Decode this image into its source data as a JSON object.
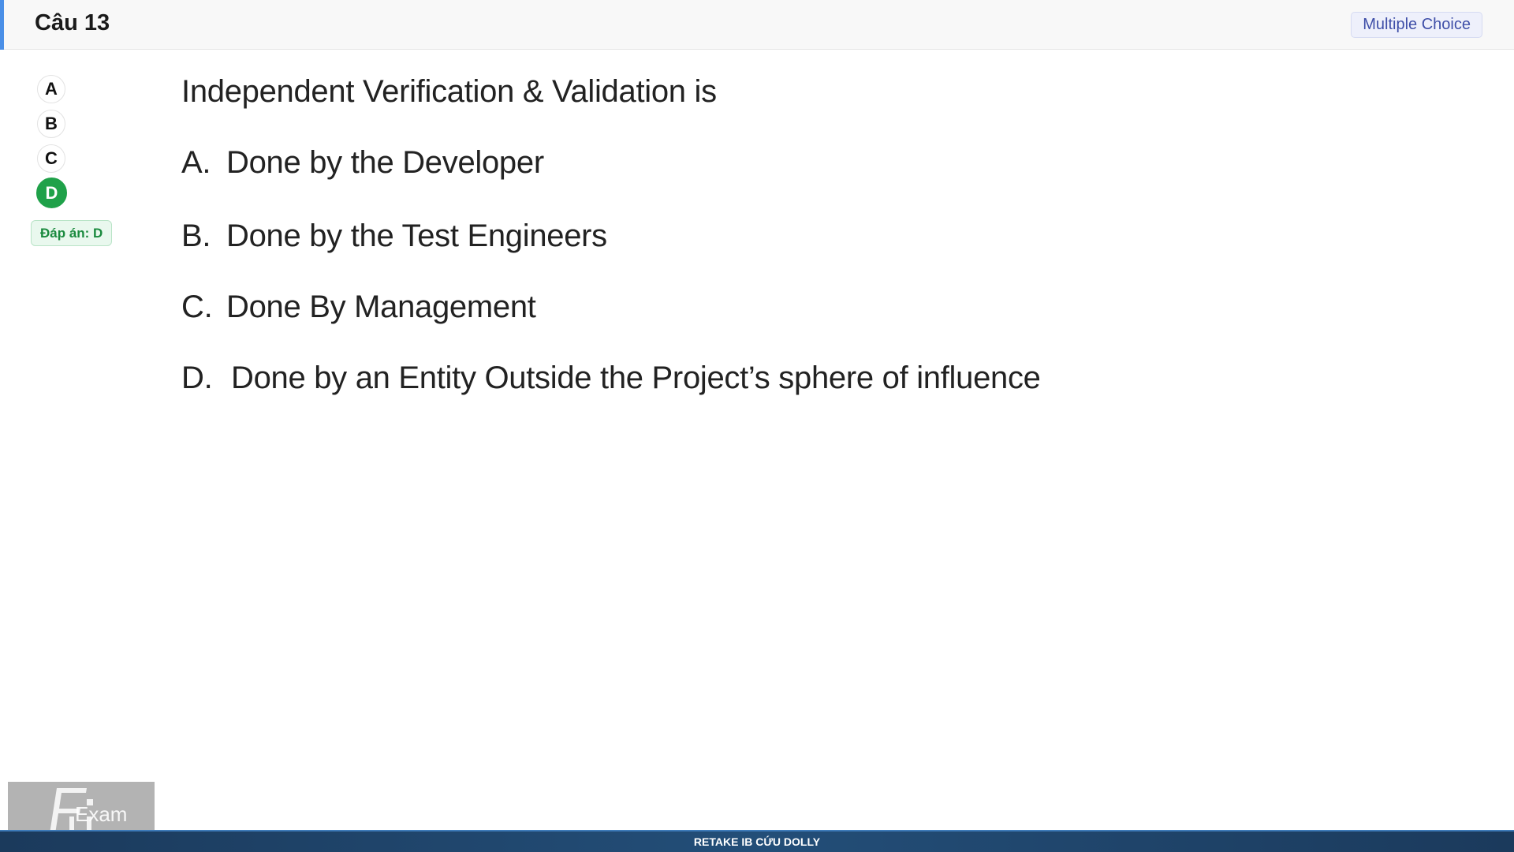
{
  "header": {
    "title": "Câu 13",
    "type_badge": "Multiple Choice"
  },
  "answer_panel": {
    "options": [
      "A",
      "B",
      "C",
      "D"
    ],
    "selected": "D",
    "answer_tag": "Đáp án: D"
  },
  "question": {
    "text": "Independent Verification & Validation is",
    "choices": [
      {
        "letter": "A.",
        "text": "Done by the Developer"
      },
      {
        "letter": "B.",
        "text": "Done by the Test Engineers"
      },
      {
        "letter": "C.",
        "text": "Done By Management"
      },
      {
        "letter": "D.",
        "text": "Done by an Entity Outside the Project’s sphere of influence"
      }
    ]
  },
  "watermark": {
    "logo_text": "Exam"
  },
  "footer": {
    "text": "RETAKE IB CỨU DOLLY"
  },
  "colors": {
    "header_accent": "#4a8fe7",
    "selected_option": "#1fa149",
    "type_badge_text": "#3f4fa8",
    "footer_bg": "#1b3a5c"
  }
}
